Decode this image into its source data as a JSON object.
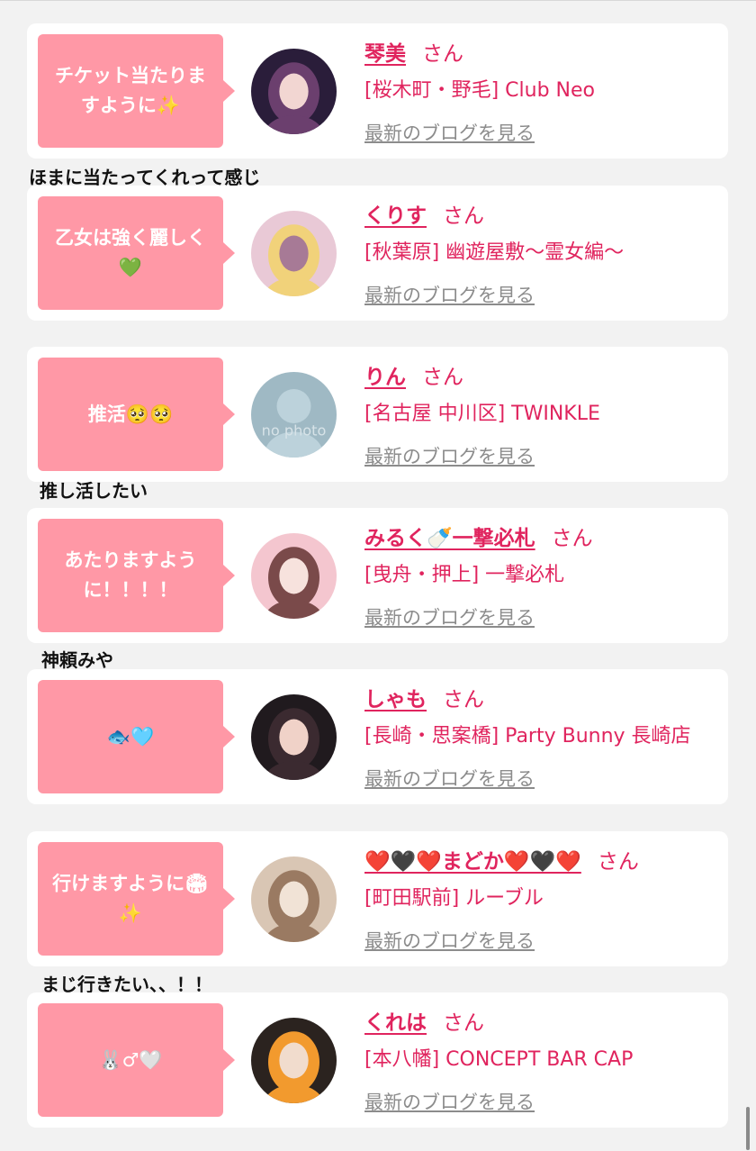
{
  "entries": [
    {
      "bubble": "チケット当たりますように✨",
      "name": "琴美",
      "suffix": "さん",
      "shop": "[桜木町・野毛] Club Neo",
      "blog_link": "最新のブログを見る",
      "avatar_colors": [
        "#2a1d3a",
        "#6b3f6e",
        "#f2d6d2"
      ]
    },
    {
      "bubble": "乙女は強く麗しく💚",
      "name": "くりす",
      "suffix": "さん",
      "shop": "[秋葉原] 幽遊屋敷〜霊女編〜",
      "blog_link": "最新のブログを見る",
      "avatar_colors": [
        "#e9c9d6",
        "#f1d27a",
        "#a77a96"
      ]
    },
    {
      "bubble": "推活🥺🥺",
      "name": "りん",
      "suffix": "さん",
      "shop": "[名古屋 中川区] TWINKLE",
      "blog_link": "最新のブログを見る",
      "avatar_colors": [
        "#9fb9c4",
        "#bcd2db",
        "#d7e3e8"
      ],
      "avatar_text": "no photo"
    },
    {
      "bubble": "あたりますように！！！！",
      "name": "みるく🍼一撃必札",
      "suffix": "さん",
      "shop": "[曳舟・押上] 一撃必札",
      "blog_link": "最新のブログを見る",
      "avatar_colors": [
        "#f4c6cf",
        "#7a4a4a",
        "#f7e2dd"
      ]
    },
    {
      "bubble": "🐟🩵",
      "name": "しゃも",
      "suffix": "さん",
      "shop": "[長崎・思案橋] Party Bunny 長崎店",
      "blog_link": "最新のブログを見る",
      "avatar_colors": [
        "#201a1e",
        "#3b2a30",
        "#f0d2c8"
      ]
    },
    {
      "bubble": "行けますように🏟✨",
      "name": "❤️🖤❤️まどか❤️🖤❤️",
      "suffix": "さん",
      "shop": "[町田駅前] ルーブル",
      "blog_link": "最新のブログを見る",
      "avatar_colors": [
        "#d9c6b4",
        "#9a7a62",
        "#f1e3d6"
      ]
    },
    {
      "bubble": "🐰♂🤍",
      "name": "くれは",
      "suffix": "さん",
      "shop": "[本八幡] CONCEPT BAR CAP",
      "blog_link": "最新のブログを見る",
      "avatar_colors": [
        "#2b231f",
        "#f29a2e",
        "#f1dccd"
      ]
    }
  ],
  "comments": [
    "ほまに当たってくれって感じ",
    "推し活したい",
    "神頼みや",
    "まじ行きたい、、！！"
  ]
}
